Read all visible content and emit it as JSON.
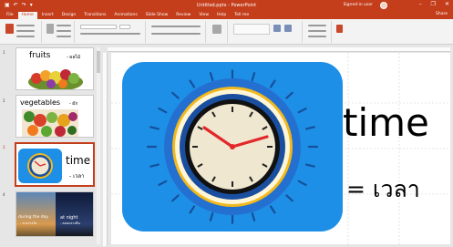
{
  "window": {
    "title": "Untitled.pptx - PowerPoint",
    "user_label": "Signed-in user",
    "controls": [
      "–",
      "❐",
      "✕"
    ]
  },
  "ribbon_tabs": [
    "File",
    "Home",
    "Insert",
    "Design",
    "Transitions",
    "Animations",
    "Slide Show",
    "Review",
    "View",
    "Help",
    "Tell me"
  ],
  "share_label": "Share",
  "thumbnails": [
    {
      "number": "1",
      "word": "fruits",
      "meaning": "- ผลไม้"
    },
    {
      "number": "2",
      "word": "vegetables",
      "meaning": "- ผัก"
    },
    {
      "number": "3",
      "word": "time",
      "meaning": "- เวลา"
    },
    {
      "number": "4",
      "left_caption": "during the day",
      "left_sub": "- ระหว่างวัน",
      "right_caption": "at night",
      "right_sub": "- ตอนกลางคืน"
    }
  ],
  "slide": {
    "word": "time",
    "meaning": "= เวลา"
  },
  "colors": {
    "title_bar": "#c43e1c",
    "clock_bg": "#1e8fe6",
    "clock_ring": "#f2b81e"
  }
}
